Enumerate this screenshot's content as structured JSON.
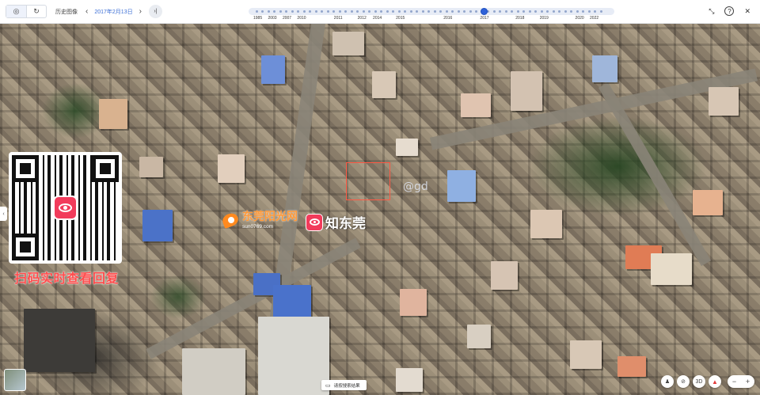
{
  "toolbar": {
    "mode_left_icon": "layers-icon",
    "mode_right_icon": "refresh-icon",
    "history_label": "历史图像",
    "prev_icon": "chevron-left-icon",
    "date": "2017年2月13日",
    "next_icon": "chevron-right-icon",
    "skip_icon": "skip-end-icon",
    "prev_glyph": "‹",
    "next_glyph": "›",
    "skip_glyph": "›|"
  },
  "timeline": {
    "years": [
      "1985",
      "2003",
      "2007",
      "2010",
      "2011",
      "2012",
      "2014",
      "2015",
      "2016",
      "2017",
      "2018",
      "2019",
      "2020",
      "2022"
    ],
    "selected_year": "2017",
    "selected_fraction": 0.645
  },
  "top_right": {
    "collapse_glyph": "⤡",
    "help_glyph": "?",
    "close_glyph": "✕"
  },
  "overlays": {
    "watermark": "@gd",
    "qr_caption": "扫码实时查看回复",
    "logo1_name": "东莞阳光网",
    "logo1_url": "sun0769.com",
    "logo2_name": "知东莞"
  },
  "side_toggle_glyph": "‹",
  "bottom_bar": {
    "pill_icon_glyph": "▭",
    "pill_label": "请按搜索结果"
  },
  "map_tools": {
    "street_view_glyph": "♟",
    "no_entry_glyph": "⊘",
    "3d_glyph": "3D",
    "compass_glyph": "▲",
    "zoom_out_glyph": "−",
    "zoom_in_glyph": "+"
  },
  "colors": {
    "accent": "#2f62d8",
    "selection_box": "#ff5a45",
    "qr_caption": "#ff4d4d",
    "brand_red": "#f23b5b",
    "brand_orange": "#ff8a1f"
  }
}
